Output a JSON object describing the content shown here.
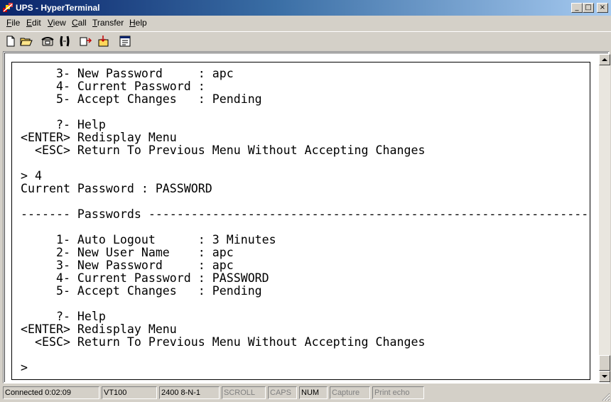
{
  "window": {
    "title": "UPS - HyperTerminal",
    "controls": {
      "minimize": "_",
      "maximize": "□",
      "close": "×"
    }
  },
  "menu": [
    {
      "label": "File"
    },
    {
      "label": "Edit"
    },
    {
      "label": "View"
    },
    {
      "label": "Call"
    },
    {
      "label": "Transfer"
    },
    {
      "label": "Help"
    }
  ],
  "toolbar": {
    "buttons": [
      {
        "name": "new-connection-icon"
      },
      {
        "name": "open-folder-icon"
      },
      {
        "name": "connect-phone-icon"
      },
      {
        "name": "disconnect-phone-icon"
      },
      {
        "name": "send-file-icon"
      },
      {
        "name": "receive-file-icon"
      },
      {
        "name": "properties-icon"
      }
    ]
  },
  "terminal": {
    "lines": [
      "     3- New Password     : apc",
      "     4- Current Password :",
      "     5- Accept Changes   : Pending",
      "",
      "     ?- Help",
      "<ENTER> Redisplay Menu",
      "  <ESC> Return To Previous Menu Without Accepting Changes",
      "",
      "> 4",
      "Current Password : PASSWORD",
      "",
      "------- Passwords ---------------------------------------------------------------",
      "",
      "     1- Auto Logout      : 3 Minutes",
      "     2- New User Name    : apc",
      "     3- New Password     : apc",
      "     4- Current Password : PASSWORD",
      "     5- Accept Changes   : Pending",
      "",
      "     ?- Help",
      "<ENTER> Redisplay Menu",
      "  <ESC> Return To Previous Menu Without Accepting Changes",
      "",
      ">"
    ]
  },
  "status": {
    "connected": "Connected 0:02:09",
    "emulation": "VT100",
    "settings": "2400 8-N-1",
    "scroll": "SCROLL",
    "caps": "CAPS",
    "num": "NUM",
    "capture": "Capture",
    "print_echo": "Print echo"
  }
}
